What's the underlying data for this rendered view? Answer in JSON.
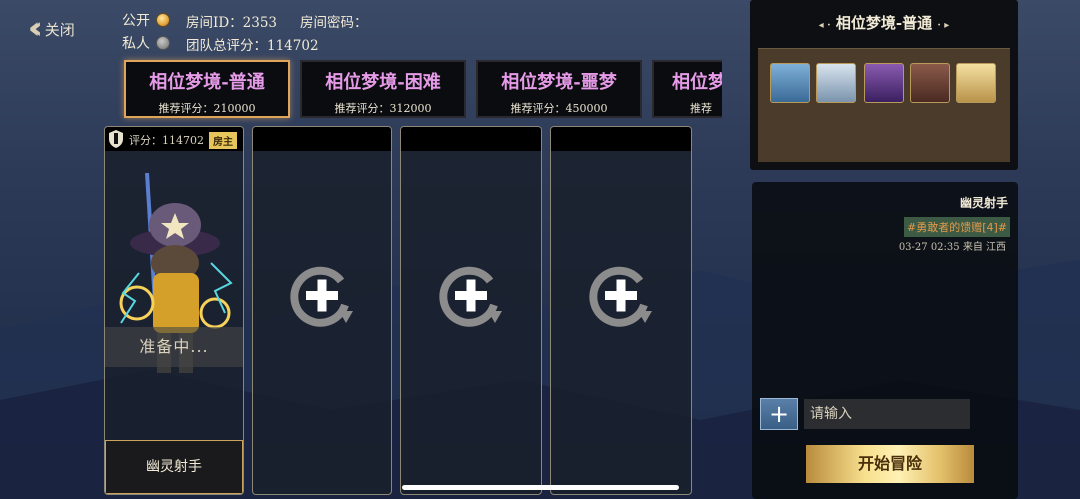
{
  "top": {
    "close_label": "关闭",
    "public_label": "公开",
    "private_label": "私人",
    "room_id": "房间ID：2353",
    "room_password": "房间密码：",
    "team_score": "团队总评分：114702"
  },
  "difficulties": [
    {
      "name": "相位梦境-普通",
      "recommend": "推荐评分：210000"
    },
    {
      "name": "相位梦境-困难",
      "recommend": "推荐评分：312000"
    },
    {
      "name": "相位梦境-噩梦",
      "recommend": "推荐评分：450000"
    },
    {
      "name": "相位梦",
      "recommend": "推荐"
    }
  ],
  "player": {
    "score": "评分：114702",
    "host_badge": "房主",
    "status": "准备中...",
    "class_name": "幽灵射手"
  },
  "reward_panel": {
    "title": "相位梦境-普通",
    "chests": [
      "blue-chest-icon",
      "silver-chest-icon",
      "purple-chest-icon",
      "brown-chest-icon",
      "gold-chest-icon"
    ]
  },
  "chat": {
    "sender": "幽灵射手",
    "message": "#勇敢者的馈赠[4]#",
    "time": "03-27 02:35 来自 江西",
    "input_placeholder": "请输入",
    "start_button": "开始冒险"
  },
  "colors": {
    "difficulty_text": "#e59be7",
    "active_border": "#e0a45a",
    "chat_highlight": "#e39a4a"
  }
}
